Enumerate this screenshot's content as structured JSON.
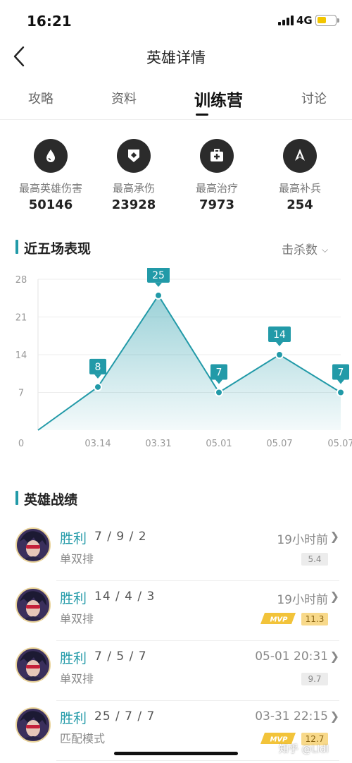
{
  "status": {
    "time": "16:21",
    "network": "4G"
  },
  "nav": {
    "title": "英雄详情"
  },
  "tabs": [
    {
      "label": "攻略",
      "active": false
    },
    {
      "label": "资料",
      "active": false
    },
    {
      "label": "训练营",
      "active": true
    },
    {
      "label": "讨论",
      "active": false
    }
  ],
  "stats": [
    {
      "label": "最高英雄伤害",
      "value": "50146",
      "icon": "blood-drop-icon"
    },
    {
      "label": "最高承伤",
      "value": "23928",
      "icon": "shield-icon"
    },
    {
      "label": "最高治疗",
      "value": "7973",
      "icon": "medkit-icon"
    },
    {
      "label": "最高补兵",
      "value": "254",
      "icon": "spearhead-icon"
    }
  ],
  "recent": {
    "title": "近五场表现",
    "metric": "击杀数"
  },
  "chart_data": {
    "type": "area",
    "x": [
      "",
      "03.14",
      "03.31",
      "05.01",
      "05.07",
      "05.07"
    ],
    "values": [
      0,
      8,
      25,
      7,
      14,
      7
    ],
    "data_labels": [
      "8",
      "25",
      "7",
      "14",
      "7"
    ],
    "yticks": [
      "0",
      "7",
      "14",
      "21",
      "28"
    ],
    "ylim": [
      0,
      28
    ],
    "grid": true,
    "color": "#229aa8"
  },
  "records_section": {
    "title": "英雄战绩"
  },
  "records": [
    {
      "result": "胜利",
      "kda": "7 / 9 / 2",
      "mode": "单双排",
      "time": "19小时前",
      "score": "5.4",
      "mvp": false
    },
    {
      "result": "胜利",
      "kda": "14 / 4 / 3",
      "mode": "单双排",
      "time": "19小时前",
      "score": "11.3",
      "mvp": true,
      "mvp_label": "MVP"
    },
    {
      "result": "胜利",
      "kda": "7 / 5 / 7",
      "mode": "单双排",
      "time": "05-01 20:31",
      "score": "9.7",
      "mvp": false
    },
    {
      "result": "胜利",
      "kda": "25 / 7 / 7",
      "mode": "匹配模式",
      "time": "03-31 22:15",
      "score": "12.7",
      "mvp": true,
      "mvp_label": "MVP"
    }
  ],
  "watermark": "知乎 @Lldl",
  "colors": {
    "accent": "#229aa8",
    "mvp_gold": "#f2c33a"
  }
}
